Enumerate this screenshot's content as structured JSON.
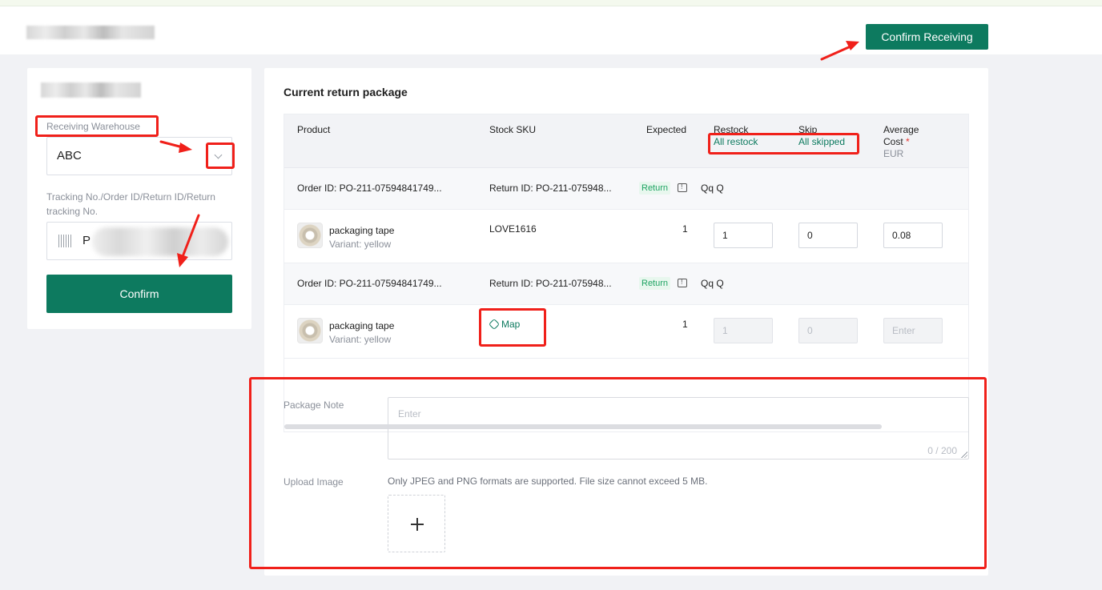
{
  "header": {
    "confirm_receiving_label": "Confirm Receiving"
  },
  "left_panel": {
    "warehouse_label": "Receiving Warehouse",
    "warehouse_value": "ABC",
    "tracking_label": "Tracking No./Order ID/Return ID/Return tracking No.",
    "tracking_value_prefix": "P",
    "confirm_label": "Confirm"
  },
  "main": {
    "title": "Current return package",
    "columns": {
      "product": "Product",
      "stock_sku": "Stock SKU",
      "expected": "Expected",
      "restock": "Restock",
      "restock_action": "All restock",
      "skip": "Skip",
      "skip_action": "All skipped",
      "avg_cost_line1": "Average",
      "avg_cost_line2": "Cost",
      "required_mark": "*",
      "avg_cost_unit": "EUR"
    },
    "groups": [
      {
        "order_id": "Order ID: PO-211-07594841749...",
        "return_id": "Return ID: PO-211-075948...",
        "tag": "Return",
        "name": "Qq Q",
        "item": {
          "product_name": "packaging tape",
          "variant": "Variant: yellow",
          "sku": "LOVE1616",
          "expected": "1",
          "restock": "1",
          "skip": "0",
          "avg_cost": "0.08"
        }
      },
      {
        "order_id": "Order ID: PO-211-07594841749...",
        "return_id": "Return ID: PO-211-075948...",
        "tag": "Return",
        "name": "Qq Q",
        "item": {
          "product_name": "packaging tape",
          "variant": "Variant: yellow",
          "sku_link": "Map",
          "expected": "1",
          "restock": "1",
          "skip": "0",
          "avg_cost_placeholder": "Enter"
        }
      }
    ],
    "package_note_label": "Package Note",
    "package_note_placeholder": "Enter",
    "package_note_count": "0 / 200",
    "upload_label": "Upload Image",
    "upload_hint": "Only JPEG and PNG formats are supported. File size cannot exceed 5 MB.",
    "upload_plus": "+"
  },
  "colors": {
    "primary": "#0d7a5f",
    "annotation": "#f0201a"
  }
}
